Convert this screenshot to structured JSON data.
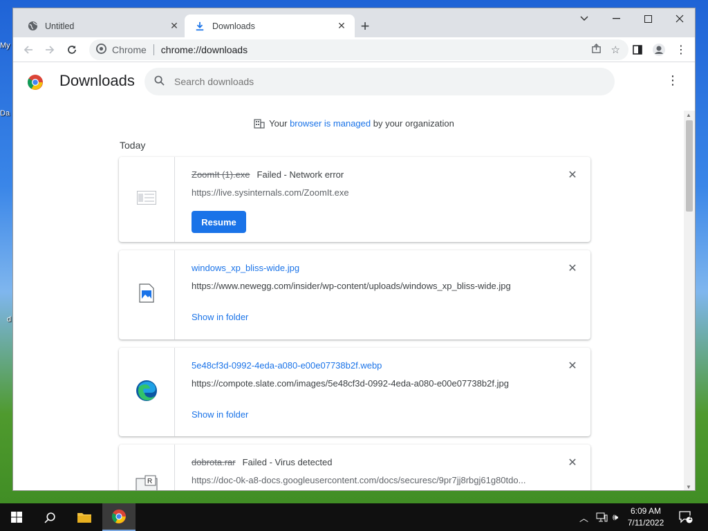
{
  "desktop": {
    "labels": [
      "My",
      "Da",
      "d"
    ]
  },
  "tabs": [
    {
      "title": "Untitled",
      "icon": "globe-icon"
    },
    {
      "title": "Downloads",
      "icon": "download-icon"
    }
  ],
  "toolbar": {
    "omnibox_chrome_label": "Chrome",
    "omnibox_url": "chrome://downloads"
  },
  "downloads_page": {
    "title": "Downloads",
    "search_placeholder": "Search downloads",
    "managed_prefix": "Your ",
    "managed_link": "browser is managed",
    "managed_suffix": " by your organization",
    "section_label": "Today"
  },
  "items": [
    {
      "filename": "ZoomIt (1).exe",
      "status": "Failed - Network error",
      "url": "https://live.sysinternals.com/ZoomIt.exe",
      "action": "Resume"
    },
    {
      "filename": "windows_xp_bliss-wide.jpg",
      "url": "https://www.newegg.com/insider/wp-content/uploads/windows_xp_bliss-wide.jpg",
      "action": "Show in folder"
    },
    {
      "filename": "5e48cf3d-0992-4eda-a080-e00e07738b2f.webp",
      "url": "https://compote.slate.com/images/5e48cf3d-0992-4eda-a080-e00e07738b2f.jpg",
      "action": "Show in folder"
    },
    {
      "filename": "dobrota.rar",
      "status": "Failed - Virus detected",
      "url": "https://doc-0k-a8-docs.googleusercontent.com/docs/securesc/9pr7jj8rbgj61g80tdo..."
    }
  ],
  "taskbar": {
    "time": "6:09 AM",
    "date": "7/11/2022",
    "notification_count": "1"
  },
  "colors": {
    "accent": "#1a73e8",
    "tabstrip": "#dee1e6"
  }
}
